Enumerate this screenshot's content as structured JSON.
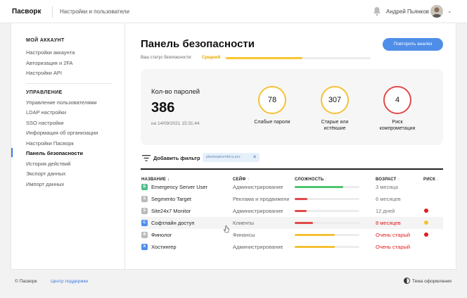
{
  "header": {
    "brand": "Пасворк",
    "section": "Настройки и пользователи",
    "user": "Андрей Пьянков"
  },
  "sidebar": {
    "account_heading": "МОЙ АККАУНТ",
    "account_items": [
      "Настройки аккаунта",
      "Авторизация и 2FA",
      "Настройки API"
    ],
    "manage_heading": "УПРАВЛЕНИЕ",
    "manage_items": [
      "Управление пользователями",
      "LDAP настройки",
      "SSO настройки",
      "Информация об организации",
      "Настройки Пасворк",
      "Панель безопасности",
      "История действий",
      "Экспорт данных",
      "Импорт данных"
    ],
    "active_index": 5
  },
  "main": {
    "title": "Панель безопасности",
    "repeat_button": "Повторить анализ",
    "status_label": "Ваш статус безопасности:",
    "status_value": "Средний",
    "status_fraction": 0.53,
    "card": {
      "count_label": "Кол-во паролей",
      "count": "386",
      "date": "на 14/09/2021 15:31:44",
      "metrics": [
        {
          "value": "78",
          "label": "Слабые пароли",
          "color": "#f5c234"
        },
        {
          "value": "307",
          "label": "Старые или истёкшие",
          "color": "#f5c234"
        },
        {
          "value": "4",
          "label": "Риск компрометации",
          "color": "#e14a4a"
        }
      ]
    },
    "filter": {
      "label": "Добавить фильтр",
      "chip": "plankopkomfera.pro"
    },
    "table": {
      "headers": {
        "name": "НАЗВАНИЕ",
        "safe": "СЕЙФ",
        "complexity": "СЛОЖНОСТЬ",
        "age": "ВОЗРАСТ",
        "risk": "РИСК"
      },
      "rows": [
        {
          "letter": "E",
          "name": "Emergency Server User",
          "badge": "#4fbf8b",
          "safe": "Администрирование",
          "complexity": 0.75,
          "bar": "#4fc46d",
          "age": "3 месяца",
          "age_color": "#777",
          "risk": ""
        },
        {
          "letter": "S",
          "name": "Segmento Target",
          "badge": "#b9b9b9",
          "safe": "Реклама и продвижение",
          "complexity": 0.2,
          "bar": "#e14a4a",
          "age": "6 месяцев",
          "age_color": "#777",
          "risk": ""
        },
        {
          "letter": "S",
          "name": "Site24x7 Monitor",
          "badge": "#b9b9b9",
          "safe": "Администрирование",
          "complexity": 0.18,
          "bar": "#e14a4a",
          "age": "12 дней",
          "age_color": "#777",
          "risk": "#e11d1d"
        },
        {
          "letter": "С",
          "name": "Софтлайн доступ",
          "badge": "#4f8ee8",
          "safe": "Клиенты",
          "complexity": 0.28,
          "bar": "#e14a4a",
          "age": "8 месяцев",
          "age_color": "#e11d1d",
          "risk": "#f5c234"
        },
        {
          "letter": "Ф",
          "name": "Финолог",
          "badge": "#b9b9b9",
          "safe": "Финансы",
          "complexity": 0.62,
          "bar": "#f5c234",
          "age": "Очень старый",
          "age_color": "#e11d1d",
          "risk": "#e11d1d"
        },
        {
          "letter": "X",
          "name": "Хостингер",
          "badge": "#4f8ee8",
          "safe": "Администрирование",
          "complexity": 0.62,
          "bar": "#f5c234",
          "age": "Очень старый",
          "age_color": "#e11d1d",
          "risk": ""
        }
      ]
    }
  },
  "footer": {
    "copyright": "© Пасворк",
    "support": "Центр поддержки",
    "theme": "Тема оформления"
  }
}
